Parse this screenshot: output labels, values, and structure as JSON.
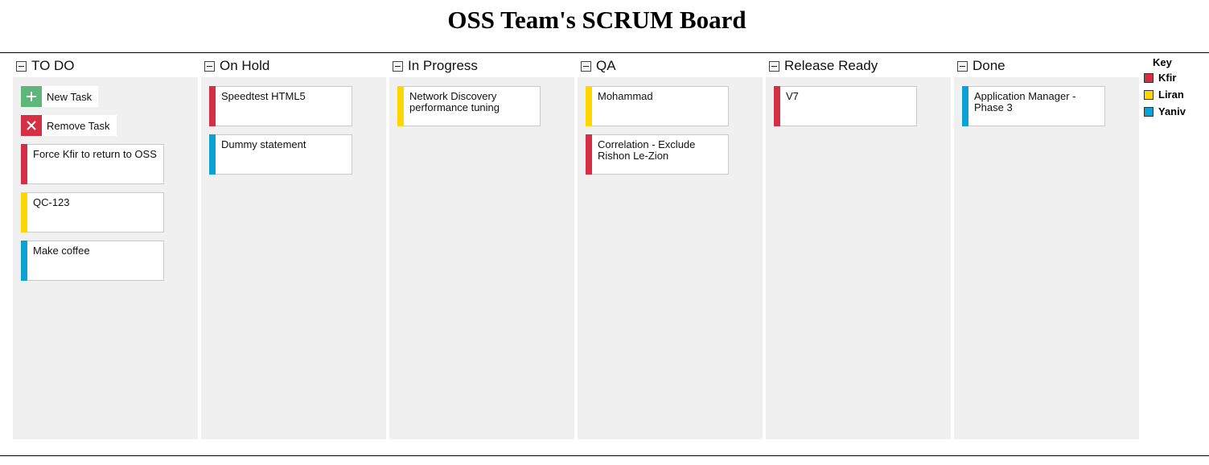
{
  "title": "OSS Team's SCRUM Board",
  "colors": {
    "kfir": "#d42f45",
    "liran": "#ffd600",
    "yaniv": "#0ba3d6",
    "add_button": "#5fb67a",
    "remove_button": "#d42f45"
  },
  "actions": {
    "new_task": "New Task",
    "remove_task": "Remove Task"
  },
  "columns": [
    {
      "title": "TO DO",
      "tasks": [
        {
          "text": "Force Kfir to return to OSS",
          "owner": "kfir"
        },
        {
          "text": "QC-123",
          "owner": "liran"
        },
        {
          "text": "Make coffee",
          "owner": "yaniv"
        }
      ]
    },
    {
      "title": "On Hold",
      "tasks": [
        {
          "text": "Speedtest HTML5",
          "owner": "kfir"
        },
        {
          "text": "Dummy statement",
          "owner": "yaniv"
        }
      ]
    },
    {
      "title": "In Progress",
      "tasks": [
        {
          "text": "Network Discovery performance tuning",
          "owner": "liran"
        }
      ]
    },
    {
      "title": "QA",
      "tasks": [
        {
          "text": "Mohammad",
          "owner": "liran"
        },
        {
          "text": "Correlation - Exclude Rishon Le-Zion",
          "owner": "kfir"
        }
      ]
    },
    {
      "title": "Release Ready",
      "tasks": [
        {
          "text": "V7",
          "owner": "kfir"
        }
      ]
    },
    {
      "title": "Done",
      "tasks": [
        {
          "text": "Application Manager - Phase 3",
          "owner": "yaniv"
        }
      ]
    }
  ],
  "key": {
    "title": "Key",
    "items": [
      {
        "label": "Kfir",
        "owner": "kfir"
      },
      {
        "label": "Liran",
        "owner": "liran"
      },
      {
        "label": "Yaniv",
        "owner": "yaniv"
      }
    ]
  }
}
